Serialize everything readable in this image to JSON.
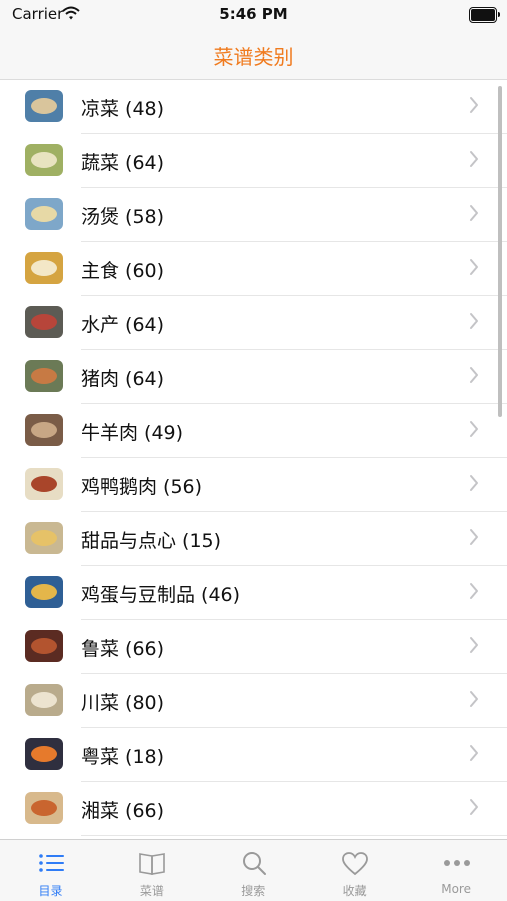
{
  "status_bar": {
    "carrier": "Carrier",
    "time": "5:46 PM"
  },
  "nav": {
    "title": "菜谱类别",
    "accent_color": "#f07b1f"
  },
  "categories": [
    {
      "label": "凉菜 (48)",
      "colors": [
        "#4f7fa8",
        "#d9c59c"
      ]
    },
    {
      "label": "蔬菜 (64)",
      "colors": [
        "#9fb063",
        "#e8e3c0"
      ]
    },
    {
      "label": "汤煲 (58)",
      "colors": [
        "#7ea7c9",
        "#e7d9a6"
      ]
    },
    {
      "label": "主食 (60)",
      "colors": [
        "#d5a441",
        "#f3e7c7"
      ]
    },
    {
      "label": "水产 (64)",
      "colors": [
        "#5c5b54",
        "#b7453a"
      ]
    },
    {
      "label": "猪肉 (64)",
      "colors": [
        "#6b7a56",
        "#c77a44"
      ]
    },
    {
      "label": "牛羊肉 (49)",
      "colors": [
        "#7a5c47",
        "#c8a785"
      ]
    },
    {
      "label": "鸡鸭鹅肉 (56)",
      "colors": [
        "#e7ddc4",
        "#a9452a"
      ]
    },
    {
      "label": "甜品与点心 (15)",
      "colors": [
        "#c9b892",
        "#e6c268"
      ]
    },
    {
      "label": "鸡蛋与豆制品 (46)",
      "colors": [
        "#2f5f95",
        "#e4b64a"
      ]
    },
    {
      "label": "鲁菜 (66)",
      "colors": [
        "#5b2b22",
        "#b3542f"
      ]
    },
    {
      "label": "川菜 (80)",
      "colors": [
        "#b9ab8c",
        "#ece3cf"
      ]
    },
    {
      "label": "粤菜 (18)",
      "colors": [
        "#2f2f3f",
        "#e67a2c"
      ]
    },
    {
      "label": "湘菜 (66)",
      "colors": [
        "#d8b98c",
        "#c9652f"
      ]
    }
  ],
  "tabs": [
    {
      "label": "目录",
      "icon": "list-icon",
      "active": true
    },
    {
      "label": "菜谱",
      "icon": "book-icon",
      "active": false
    },
    {
      "label": "搜索",
      "icon": "search-icon",
      "active": false
    },
    {
      "label": "收藏",
      "icon": "heart-icon",
      "active": false
    },
    {
      "label": "More",
      "icon": "more-icon",
      "active": false
    }
  ],
  "tab_active_color": "#2f7cf6",
  "tab_inactive_color": "#9a9a9a"
}
